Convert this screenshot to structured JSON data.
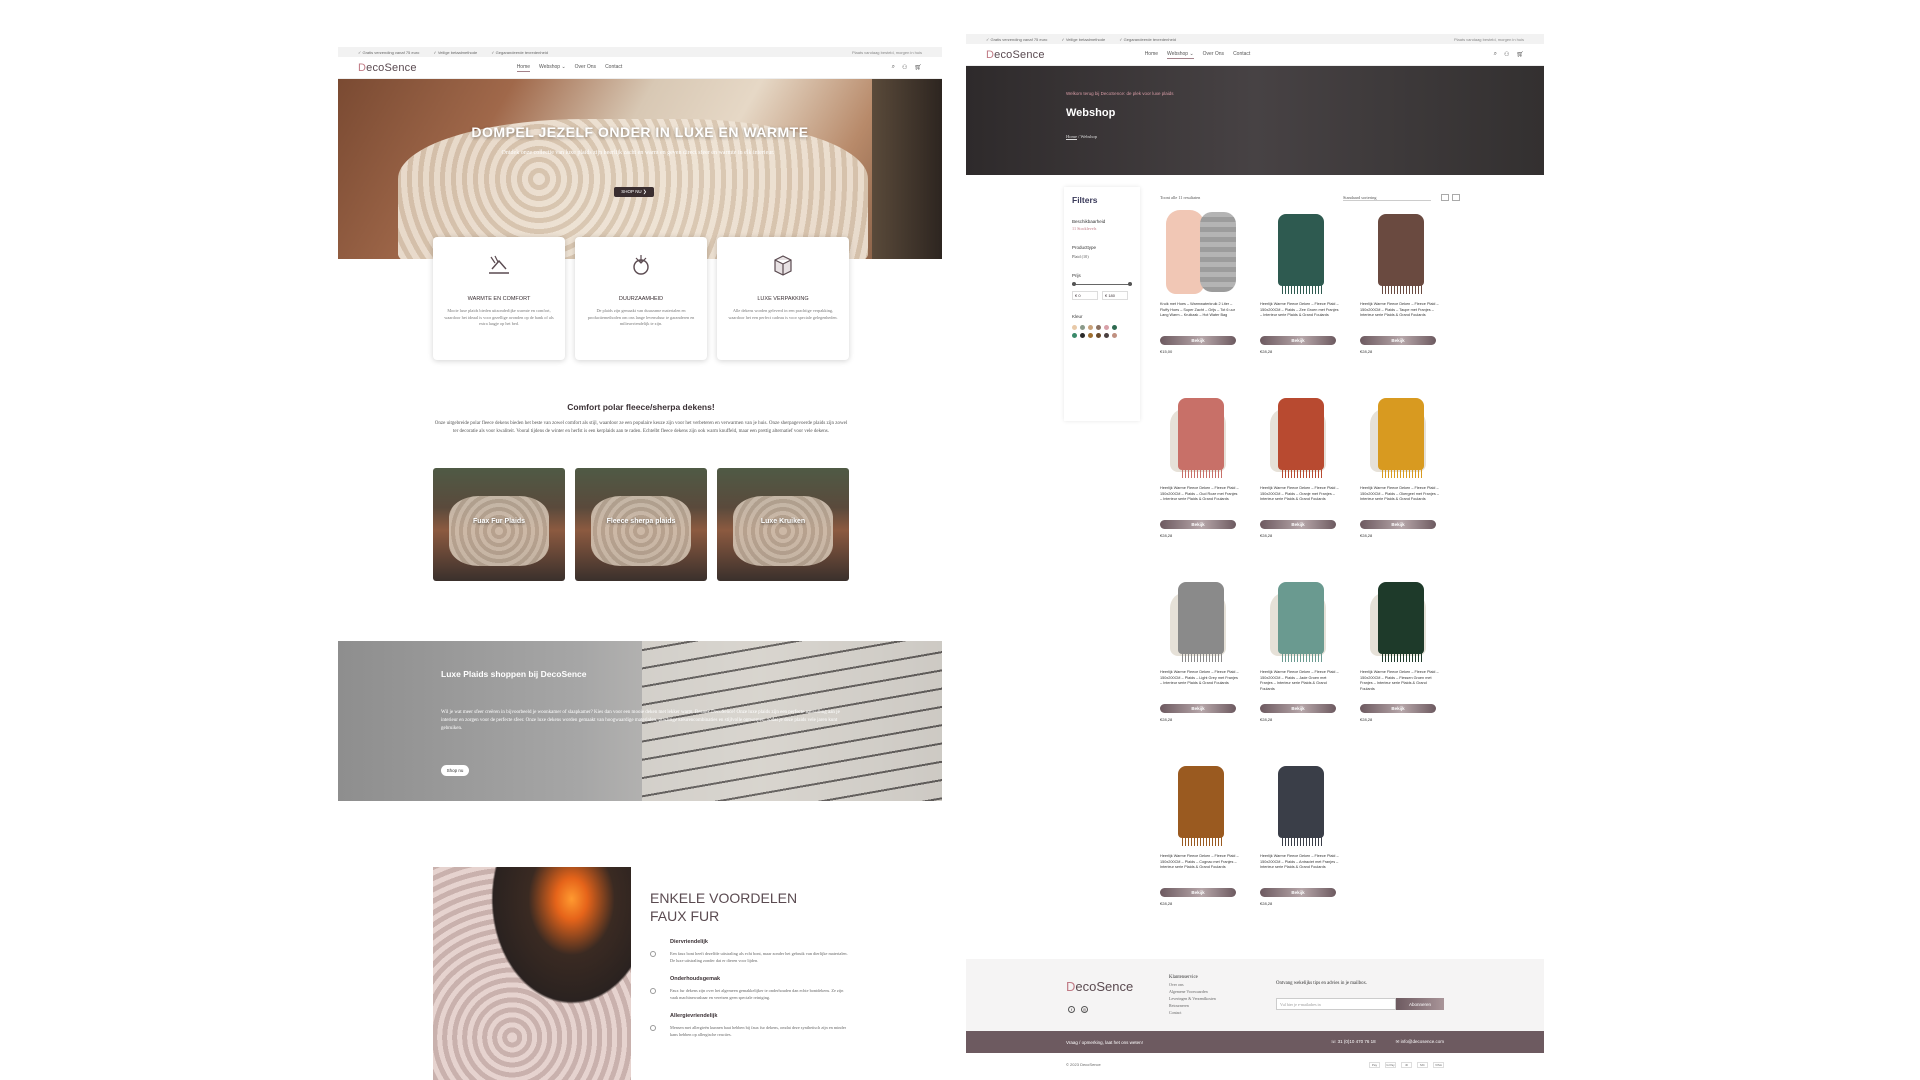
{
  "left": {
    "topbar": {
      "items": [
        "✓ Gratis verzending vanaf 75 euro",
        "✓ Veilige betaalmethode",
        "✓ Gegarandeerde tevredenheid"
      ],
      "right": "Plaats vandaag besteld, morgen in huis"
    },
    "logo": {
      "d": "D",
      "rest": "ecoSence"
    },
    "nav": [
      "Home",
      "Webshop ⌄",
      "Over Ons",
      "Contact"
    ],
    "hero": {
      "title": "DOMPEL JEZELF ONDER IN LUXE EN WARMTE",
      "subtitle": "Ontdek onze collectie van luxe plaids zijn heerlijk zacht en warm en geven direct sfeer en warmte in elk interieur.",
      "button": "SHOP NU ❯"
    },
    "features": [
      {
        "title": "WARMTE EN COMFORT",
        "text": "Mooie luxe plaids bieden uitzonderlijke warmte en comfort, waardoor het ideaal is voor gezellige avonden op de bank of als extra laagje op het bed."
      },
      {
        "title": "DUURZAAMHEID",
        "text": "De plaids zijn gemaakt van duurzame materialen en productiemethoden om ons lange levensduur te garanderen en milieuvriendelijk te zijn."
      },
      {
        "title": "LUXE VERPAKKING",
        "text": "Alle dekens worden geleverd in een prachtige verpakking, waardoor het een perfect cadeau is voor speciale gelegenheden."
      }
    ],
    "intro": {
      "title": "Comfort polar fleece/sherpa dekens!",
      "text": "Onze uitgebreide polar fleece dekens bieden het beste van zowel comfort als stijl, waardoor ze een populaire keuze zijn voor het verbeteren en verwarmen van je huis. Onze sherpagevoerde plaids zijn zowel ter decoratie als voor kwaliteit. Vooral tijdens de winter en herfst is een kerplaids aan te raden. Echtelbt fleece dekens zijn ook warm knuffeld, maar een prettig alternatief voor vele dekens."
    },
    "categories": [
      "Fuax Fur Plaids",
      "Fleece sherpa plaids",
      "Luxe Kruiken"
    ],
    "banner": {
      "title": "Luxe Plaids shoppen bij DecoSence",
      "text": "Wil je wat meer sfeer creëren in bijvoorbeeld je woonkamer of slaapkamer? Kies dan voor een mooie deken met lekker warm. Bezoek DecoSence! Onze luxe plaids zijn een perfecte aanvulling aan je interieur en zorgen voor de perfecte sfeer. Onze luxe dekens worden gemaakt van hoogwaardige materialen, prachtige kleurencombinaties en stijlvolle ontwerpen, zodat je deze plaids vele jaren kunt gebruiken.",
      "button": "Shop nu"
    },
    "advantages": {
      "title_line1": "ENKELE VOORDELEN",
      "title_line2": "FAUX FUR",
      "items": [
        {
          "title": "Diervriendelijk",
          "text": "Een faux bont heeft dezelfde uitstraling als echt bont, maar zonder het gebruik van dierlijke materialen. De luxe uitstraling zonder dat er dieren voor lijden."
        },
        {
          "title": "Onderhoudsgemak",
          "text": "Faux fur dekens zijn over het algemeen gemakkelijker te onderhouden dan echte bontdekens. Ze zijn vaak machinewasbaar en vereisen geen speciale reiniging."
        },
        {
          "title": "Allergievriendelijk",
          "text": "Mensen met allergieën kunnen baat hebben bij faux fur dekens, omdat deze synthetisch zijn en minder kans hebben op allergische reacties."
        }
      ]
    }
  },
  "right": {
    "topbar": {
      "items": [
        "✓ Gratis verzending vanaf 75 euro",
        "✓ Veilige betaalmethode",
        "✓ Gegarandeerde tevredenheid"
      ],
      "right": "Plaats vandaag besteld, morgen in huis"
    },
    "logo": {
      "d": "D",
      "rest": "ecoSence"
    },
    "nav": [
      "Home",
      "Webshop ⌄",
      "Over Ons",
      "Contact"
    ],
    "hero": {
      "eyebrow": "Welkom terug bij DecoSence: de plek voor luxe plaids",
      "title": "Webshop",
      "crumb_home": "Home",
      "crumb_sep": " / ",
      "crumb_current": "Webshop"
    },
    "filters": {
      "title": "Filters",
      "availability_label": "Beschikbaarheid",
      "availability_value": "11 Stocklevels",
      "product_type_label": "Producttype",
      "product_type_value": "Plaid (10)",
      "price_label": "Prijs",
      "price_min": "€ 0",
      "price_max": "€ 180",
      "color_label": "Kleur",
      "swatches": [
        "#e8c9a8",
        "#8a9a8a",
        "#c9a27a",
        "#8a7060",
        "#d8a0a8",
        "#2e6a50",
        "#3a8a6a",
        "#2a2a2a",
        "#a07030",
        "#6a4a2a",
        "#4a4040",
        "#c09080"
      ]
    },
    "toolbar": {
      "count": "Toont alle 11 resultaten",
      "sort": "Standaard sortering"
    },
    "products": [
      {
        "name": "Kruik met Hoes – Warmwaterkruik 2 Liter – Fluffy Hoes – Super Zacht – Grijs – Tot 6 uur Lang Warm – Kruikzak – Hot Water Bag",
        "price": "€15,00",
        "button": "Bekijk",
        "kind": "bottle",
        "color": "#9c9c9c"
      },
      {
        "name": "Heerlijk Warme Fleece Deken – Fleece Plaid – 150x200CM – Plaids – Zee Groen met Franjes – Interieur serie Plaids & Grand Foulards",
        "price": "€28,28",
        "button": "Bekijk",
        "kind": "throw",
        "color": "#2e5a50"
      },
      {
        "name": "Heerlijk Warme Fleece Deken – Fleece Plaid – 150x200CM – Plaids – Taupe met Franjes – Interieur serie Plaids & Grand Foulards",
        "price": "€28,28",
        "button": "Bekijk",
        "kind": "throw",
        "color": "#6a4a40"
      },
      {
        "name": "Heerlijk Warme Fleece Deken – Fleece Plaid – 150x200CM – Plaids – Oud Roze met Franjes – Interieur serie Plaids & Grand Foulards",
        "price": "€28,28",
        "button": "Bekijk",
        "kind": "throw-chair",
        "color": "#c87068"
      },
      {
        "name": "Heerlijk Warme Fleece Deken – Fleece Plaid – 150x200CM – Plaids – Oranje met Franjes – Interieur serie Plaids & Grand Foulards",
        "price": "€28,28",
        "button": "Bekijk",
        "kind": "throw-chair",
        "color": "#b84a30"
      },
      {
        "name": "Heerlijk Warme Fleece Deken – Fleece Plaid – 150x200CM – Plaids – Okergeel met Franjes – Interieur serie Plaids & Grand Foulards",
        "price": "€28,28",
        "button": "Bekijk",
        "kind": "throw-chair",
        "color": "#d89a20"
      },
      {
        "name": "Heerlijk Warme Fleece Deken – Fleece Plaid – 150x200CM – Plaids – Light Grey met Franjes – Interieur serie Plaids & Grand Foulards",
        "price": "€28,28",
        "button": "Bekijk",
        "kind": "throw-chair",
        "color": "#8a8a8a"
      },
      {
        "name": "Heerlijk Warme Fleece Deken – Fleece Plaid – 150x200CM – Plaids – Jade Groen met Franjes – Interieur serie Plaids & Grand Foulards",
        "price": "€28,28",
        "button": "Bekijk",
        "kind": "throw-chair",
        "color": "#6a9a90"
      },
      {
        "name": "Heerlijk Warme Fleece Deken – Fleece Plaid – 150x200CM – Plaids – Flessen Groen met Franjes – Interieur serie Plaids & Grand Foulards",
        "price": "€28,28",
        "button": "Bekijk",
        "kind": "throw-chair",
        "color": "#1e3a2a"
      },
      {
        "name": "Heerlijk Warme Fleece Deken – Fleece Plaid – 150x200CM – Plaids – Cognac met Franjes – Interieur serie Plaids & Grand Foulards",
        "price": "€28,28",
        "button": "Bekijk",
        "kind": "throw",
        "color": "#9a5a20"
      },
      {
        "name": "Heerlijk Warme Fleece Deken – Fleece Plaid – 150x200CM – Plaids – Antraciet met Franjes – Interieur serie Plaids & Grand Foulards",
        "price": "€28,28",
        "button": "Bekijk",
        "kind": "throw",
        "color": "#3a3e48"
      }
    ],
    "footer": {
      "logo_d": "D",
      "logo_rest": "ecoSence",
      "col_title": "Klantenservice",
      "col_links": [
        "Over ons",
        "Algemene Voorwaarden",
        "Leveringen & Verzendkosten",
        "Retourneren",
        "Contact"
      ],
      "news_title": "Ontvang wekelijks tips en advies in je mailbox.",
      "news_placeholder": "Vul hier je e-mailadres in",
      "news_button": "Abonneren",
      "bar_left": "Vraag / opmerking, laat het ons weten!",
      "bar_phone": "☏ 31 (0)10 470 76 18",
      "bar_mail": "✉ info@decosence.com",
      "copyright": "© 2023 DecoSence",
      "payments": [
        "Pay",
        "G Pay",
        "iD",
        "MC",
        "VISA"
      ]
    }
  }
}
